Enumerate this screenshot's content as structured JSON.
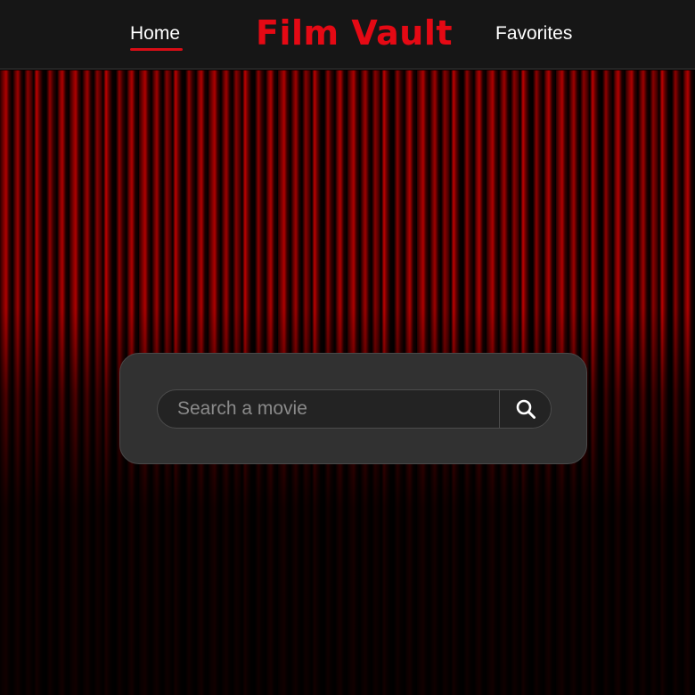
{
  "nav": {
    "home_label": "Home",
    "brand": "Film Vault",
    "favorites_label": "Favorites"
  },
  "search": {
    "placeholder": "Search a movie",
    "value": "",
    "button_icon": "search-icon"
  },
  "colors": {
    "accent": "#e50914",
    "navbar": "#161616",
    "card": "#313131",
    "curtain": "#8a0000"
  }
}
